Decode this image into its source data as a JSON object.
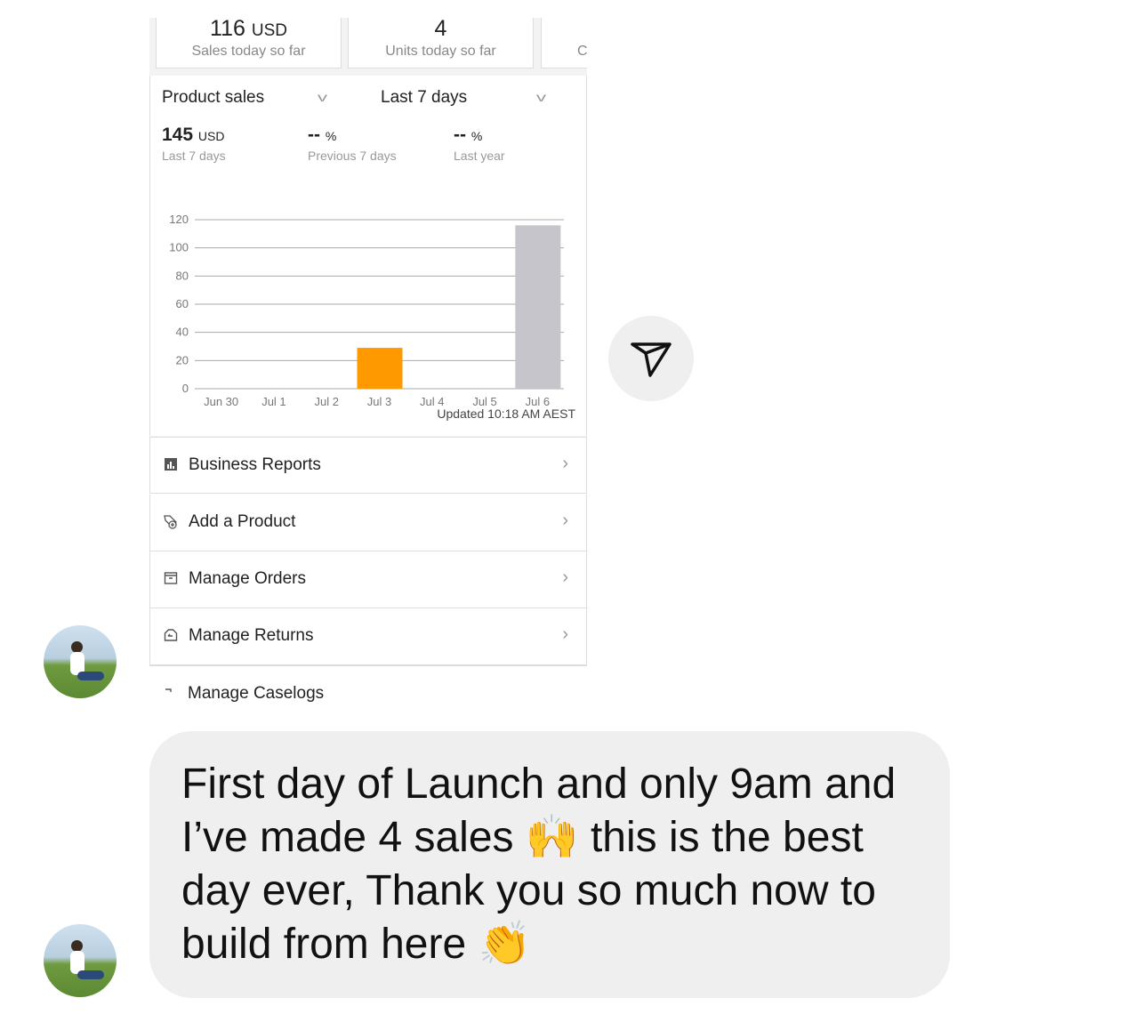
{
  "screenshot": {
    "cards": [
      {
        "value": "116",
        "unit": "USD",
        "label": "Sales today so far"
      },
      {
        "value": "4",
        "unit": "",
        "label": "Units today so far"
      },
      {
        "value": "",
        "unit": "",
        "label": "C"
      }
    ],
    "metric_dropdown": "Product sales",
    "range_dropdown": "Last 7 days",
    "metrics": [
      {
        "value": "145",
        "unit": "USD",
        "label": "Last 7 days"
      },
      {
        "value": "--",
        "unit": "%",
        "label": "Previous 7 days"
      },
      {
        "value": "--",
        "unit": "%",
        "label": "Last year"
      }
    ],
    "updated": "Updated 10:18 AM AEST",
    "menu": [
      {
        "label": "Business Reports",
        "icon": "bar-chart-icon"
      },
      {
        "label": "Add a Product",
        "icon": "tag-plus-icon"
      },
      {
        "label": "Manage Orders",
        "icon": "box-icon"
      },
      {
        "label": "Manage Returns",
        "icon": "return-box-icon"
      },
      {
        "label": "Manage Caselogs",
        "icon": "caselog-icon"
      }
    ]
  },
  "chart_data": {
    "type": "bar",
    "categories": [
      "Jun 30",
      "Jul 1",
      "Jul 2",
      "Jul 3",
      "Jul 4",
      "Jul 5",
      "Jul 6"
    ],
    "values": [
      0,
      0,
      0,
      29,
      0,
      0,
      116
    ],
    "bar_colors": [
      "#ff9900",
      "#ff9900",
      "#ff9900",
      "#ff9900",
      "#ff9900",
      "#ff9900",
      "#c5c5cb"
    ],
    "yticks": [
      0,
      20,
      40,
      60,
      80,
      100,
      120
    ],
    "ylim": [
      0,
      120
    ],
    "grid": true
  },
  "message": {
    "text": "First day of Launch and only 9am and I’ve made 4 sales 🙌 this is the best day ever, Thank you so much now to build from here 👏"
  },
  "send_icon": "paper-plane-icon",
  "colors": {
    "bubble": "#efefef",
    "accent": "#ff9900"
  }
}
